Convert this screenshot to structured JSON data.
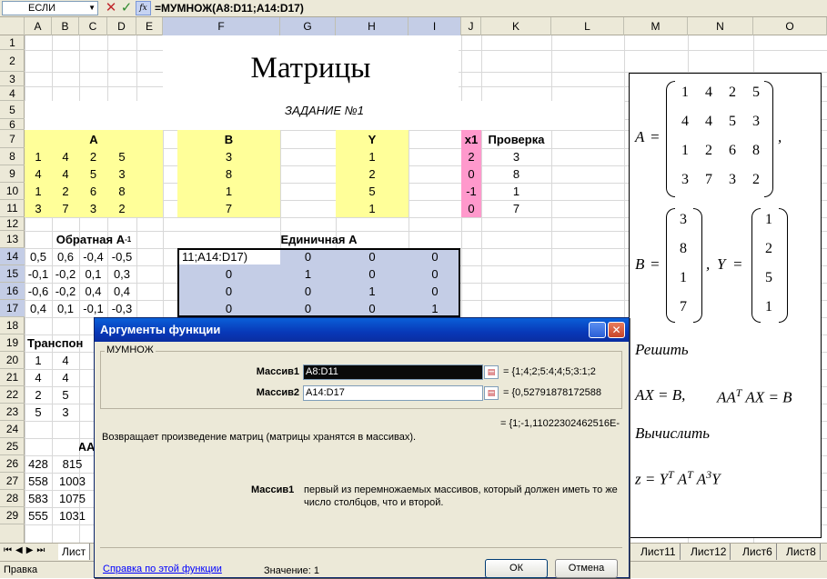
{
  "formula_bar": {
    "name_box": "ЕСЛИ",
    "formula": "=МУМНОЖ(A8:D11;A14:D17)",
    "fx_label": "fx"
  },
  "columns": [
    {
      "label": "A",
      "x": 0,
      "w": 30
    },
    {
      "label": "B",
      "x": 30,
      "w": 30
    },
    {
      "label": "C",
      "x": 60,
      "w": 32
    },
    {
      "label": "D",
      "x": 92,
      "w": 31
    }
  ],
  "sheet": {
    "title": "Матрицы",
    "task": "ЗАДАНИЕ №1",
    "label_A": "A",
    "label_B": "B",
    "label_Y": "Y",
    "label_x1": "x1",
    "label_check": "Проверка",
    "label_inverse": "Обратная A",
    "label_inverse_sup": "-1",
    "label_identity": "Единичная А",
    "label_transpose": "Транспон",
    "label_aa": "АА",
    "matrix_A": [
      [
        "1",
        "4",
        "2",
        "5"
      ],
      [
        "4",
        "4",
        "5",
        "3"
      ],
      [
        "1",
        "2",
        "6",
        "8"
      ],
      [
        "3",
        "7",
        "3",
        "2"
      ]
    ],
    "vector_B": [
      "3",
      "8",
      "1",
      "7"
    ],
    "vector_Y": [
      "1",
      "2",
      "5",
      "1"
    ],
    "vector_x1": [
      "2",
      "0",
      "-1",
      "0"
    ],
    "vector_check": [
      "3",
      "8",
      "1",
      "7"
    ],
    "inverse": [
      [
        "0,5",
        "0,6",
        "-0,4",
        "-0,5"
      ],
      [
        "-0,1",
        "-0,2",
        "0,1",
        "0,3"
      ],
      [
        "-0,6",
        "-0,2",
        "0,4",
        "0,4"
      ],
      [
        "0,4",
        "0,1",
        "-0,1",
        "-0,3"
      ]
    ],
    "identity": [
      [
        "11;A14:D17)",
        "0",
        "0",
        "0"
      ],
      [
        "0",
        "1",
        "0",
        "0"
      ],
      [
        "0",
        "0",
        "1",
        "0"
      ],
      [
        "0",
        "0",
        "0",
        "1"
      ]
    ],
    "transpose": [
      [
        "1",
        "4"
      ],
      [
        "4",
        "4"
      ],
      [
        "2",
        "5"
      ],
      [
        "5",
        "3"
      ]
    ],
    "aa": [
      [
        "428",
        "815"
      ],
      [
        "558",
        "1003"
      ],
      [
        "583",
        "1075"
      ],
      [
        "555",
        "1031"
      ]
    ]
  },
  "rows": [
    "1",
    "2",
    "3",
    "4",
    "5",
    "6",
    "7",
    "8",
    "9",
    "10",
    "11",
    "12",
    "13",
    "14",
    "15",
    "16",
    "17",
    "18",
    "19",
    "20",
    "21",
    "22",
    "23",
    "24",
    "25",
    "26",
    "27",
    "28",
    "29"
  ],
  "col_labels": [
    "A",
    "B",
    "C",
    "D",
    "E",
    "F",
    "G",
    "H",
    "I",
    "J",
    "K",
    "L",
    "M",
    "N",
    "O"
  ],
  "math": {
    "A_label": "A",
    "A_matrix": [
      [
        "1",
        "4",
        "2",
        "5"
      ],
      [
        "4",
        "4",
        "5",
        "3"
      ],
      [
        "1",
        "2",
        "6",
        "8"
      ],
      [
        "3",
        "7",
        "3",
        "2"
      ]
    ],
    "B_label": "B",
    "B_vector": [
      "3",
      "8",
      "1",
      "7"
    ],
    "Y_label": "Y",
    "Y_vector": [
      "1",
      "2",
      "5",
      "1"
    ],
    "eq": "=",
    "comma": ",",
    "solve": "Решить",
    "eq1": "AX = B,",
    "eq2a": "AA",
    "eq2sup": "T",
    "eq2b": "AX = B",
    "compute": "Вычислить",
    "z": "z = Y",
    "zsup1": "T",
    "za": "A",
    "zsup2": "T",
    "zb": "A",
    "zsup3": "3",
    "zc": "Y"
  },
  "tabs": {
    "left": "Лист",
    "right": [
      "Лист11",
      "Лист12",
      "Лист6",
      "Лист8"
    ]
  },
  "status": "Правка",
  "dialog": {
    "title": "Аргументы функции",
    "function_name": "МУМНОЖ",
    "arg1_label": "Массив1",
    "arg1_value": "A8:D11",
    "arg1_result": "= {1;4;2;5:4;4;5;3:1;2",
    "arg2_label": "Массив2",
    "arg2_value": "A14:D17",
    "arg2_result": "= {0,52791878172588",
    "total_result": "= {1;-1,11022302462516E-",
    "description": "Возвращает произведение матриц (матрицы хранятся в массивах).",
    "param_label": "Массив1",
    "param_desc_1": "первый из перемножаемых массивов, который должен иметь то же",
    "param_desc_2": "число столбцов, что и второй.",
    "help_link": "Справка по этой функции",
    "value_label": "Значение:",
    "value": "1",
    "ok": "ОК",
    "cancel": "Отмена"
  }
}
